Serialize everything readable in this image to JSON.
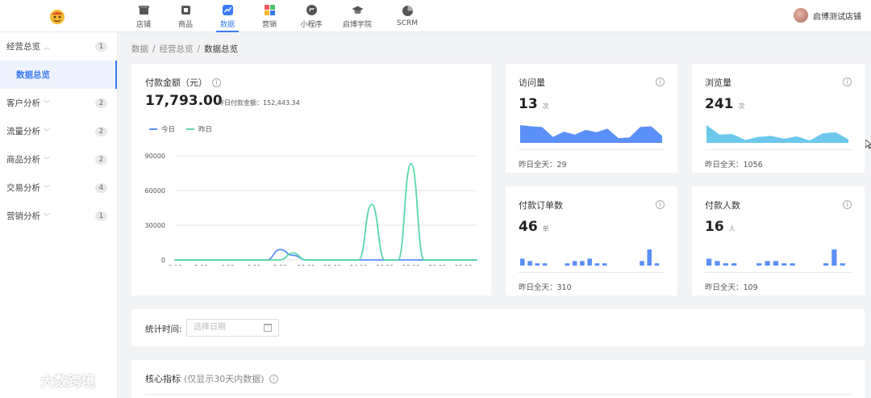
{
  "topnav": {
    "items": [
      {
        "label": "店铺",
        "icon": "store-icon"
      },
      {
        "label": "商品",
        "icon": "goods-icon"
      },
      {
        "label": "数据",
        "icon": "data-icon",
        "active": true
      },
      {
        "label": "营销",
        "icon": "marketing-icon"
      },
      {
        "label": "小程序",
        "icon": "miniprogram-icon"
      },
      {
        "label": "启博学院",
        "icon": "academy-icon"
      },
      {
        "label": "SCRM",
        "icon": "scrm-icon"
      }
    ],
    "user_name": "启博测试店铺"
  },
  "sidebar": {
    "items": [
      {
        "label": "经营总览",
        "badge": "1"
      },
      {
        "label": "客户分析",
        "badge": "2"
      },
      {
        "label": "流量分析",
        "badge": "2"
      },
      {
        "label": "商品分析",
        "badge": "2"
      },
      {
        "label": "交易分析",
        "badge": "4"
      },
      {
        "label": "营销分析",
        "badge": "1"
      }
    ],
    "active_sub": "数据总览"
  },
  "breadcrumb": [
    "数据",
    "经营总览",
    "数据总览"
  ],
  "payment": {
    "title": "付款金额（元）",
    "value": "17,793.00",
    "yesterday": "昨日付款金额：152,443.34",
    "legend_today": "今日",
    "legend_yesterday": "昨日"
  },
  "stats": {
    "visits": {
      "title": "访问量",
      "value": "13",
      "unit": "次",
      "foot": "昨日全天：29"
    },
    "views": {
      "title": "浏览量",
      "value": "241",
      "unit": "次",
      "foot": "昨日全天：1056"
    },
    "orders": {
      "title": "付款订单数",
      "value": "46",
      "unit": "单",
      "foot": "昨日全天：310"
    },
    "payers": {
      "title": "付款人数",
      "value": "16",
      "unit": "人",
      "foot": "昨日全天：109"
    }
  },
  "filter": {
    "label": "统计时间:",
    "placeholder": "选择日期"
  },
  "core": {
    "title": "核心指标",
    "subtitle": "(仅显示30天内数据)"
  },
  "watermark": "大数跨境",
  "colors": {
    "accent": "#3b7bf5",
    "today": "#5b8ff9",
    "yesterday": "#5ad8a6",
    "visits_area": "#5b8ff9",
    "views_area": "#6dc8ec"
  },
  "chart_data": {
    "type": "line",
    "x": [
      "0:00",
      "1:00",
      "2:00",
      "3:00",
      "4:00",
      "5:00",
      "6:00",
      "7:00",
      "8:00",
      "9:00",
      "10:00",
      "11:00",
      "12:00",
      "13:00",
      "14:00",
      "15:00",
      "16:00",
      "17:00",
      "18:00",
      "19:00",
      "20:00",
      "21:00",
      "22:00",
      "23:00"
    ],
    "x_tick_labels": [
      "0:00",
      "2:00",
      "4:00",
      "6:00",
      "8:00",
      "10:00",
      "12:00",
      "14:00",
      "16:00",
      "18:00",
      "20:00",
      "22:00"
    ],
    "series": [
      {
        "name": "今日",
        "color": "#5b8ff9",
        "values": [
          0,
          0,
          0,
          0,
          0,
          0,
          0,
          0,
          9000,
          4000,
          0,
          0,
          0,
          0,
          0,
          0,
          0,
          0,
          0,
          0,
          0,
          0,
          0,
          0
        ]
      },
      {
        "name": "昨日",
        "color": "#5ad8a6",
        "values": [
          0,
          0,
          0,
          0,
          0,
          0,
          0,
          0,
          0,
          6000,
          0,
          0,
          0,
          0,
          0,
          48000,
          0,
          0,
          83000,
          0,
          0,
          0,
          0,
          0
        ]
      }
    ],
    "y_ticks": [
      0,
      30000,
      60000,
      90000
    ],
    "ylim": [
      0,
      90000
    ],
    "grid": true,
    "legend": "top-left"
  },
  "sparks": {
    "visits": {
      "type": "area",
      "values": [
        3,
        2.8,
        2.7,
        1,
        1.9,
        1.4,
        2.2,
        1.8,
        2.4,
        0.8,
        0.9,
        2.7,
        2.8,
        1.2
      ]
    },
    "views": {
      "type": "area",
      "values": [
        3,
        1.4,
        1.5,
        0.5,
        1.0,
        1.2,
        0.7,
        1.1,
        0.4,
        1.6,
        1.8,
        0.6
      ]
    },
    "orders": {
      "type": "bar",
      "values": [
        3,
        2,
        1,
        1,
        0,
        0,
        1,
        2,
        2,
        3,
        1,
        1,
        0,
        0,
        0,
        0,
        2,
        7,
        1
      ]
    },
    "payers": {
      "type": "bar",
      "values": [
        3,
        2,
        1,
        1,
        0,
        0,
        1,
        2,
        2,
        1,
        1,
        0,
        0,
        0,
        1,
        7,
        1
      ]
    }
  }
}
